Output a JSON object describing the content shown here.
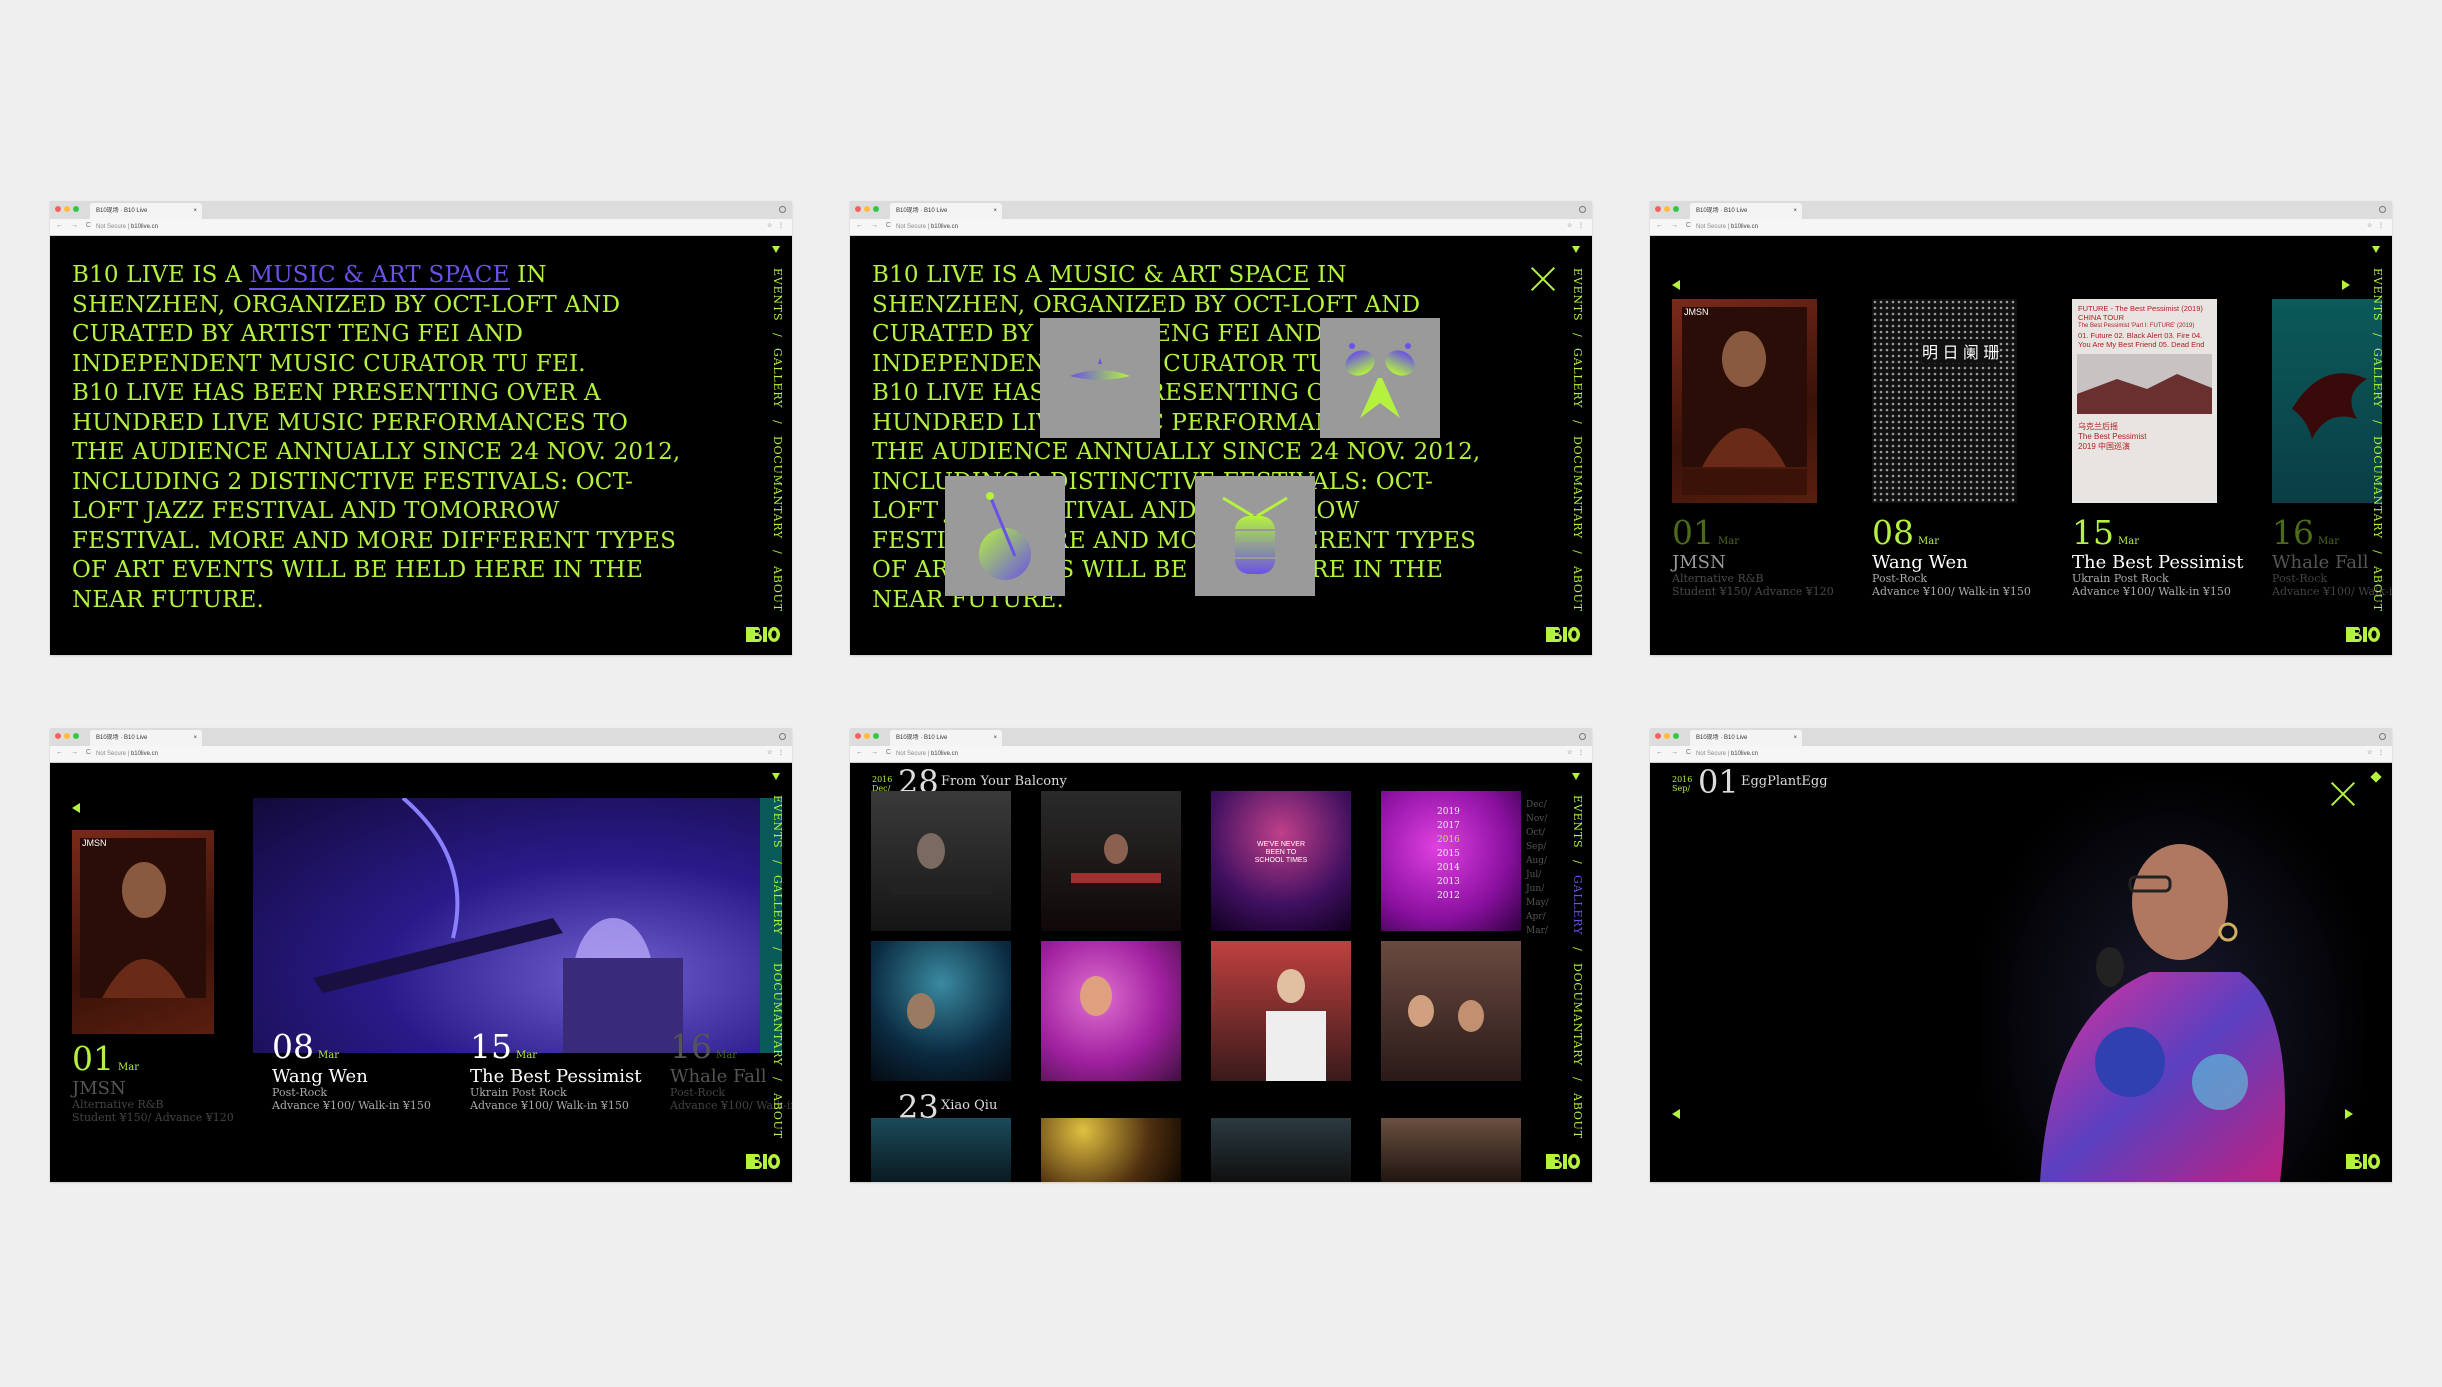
{
  "browser": {
    "tab_title": "B10现场 · B10 Live",
    "tab_close": "×",
    "not_secure": "Not Secure",
    "separator": "|",
    "url": "b10live.cn",
    "nav_glyphs": "← → C",
    "bar_icons": "☆ ⋮"
  },
  "nav": {
    "events": "EVENTS",
    "sep": "/",
    "gallery": "GALLERY",
    "documentary": "DOCUMANTARY",
    "about": "ABOUT"
  },
  "about": {
    "p1_a": "B10 LIVE IS A ",
    "p1_highlight": "MUSIC & ART SPACE",
    "p1_b": " IN SHENZHEN, ORGANIZED BY OCT-LOFT AND CURATED BY ARTIST TENG FEI AND INDEPENDENT MUSIC CURATOR TU FEI.",
    "p2": "B10 LIVE HAS BEEN PRESENTING OVER A HUNDRED LIVE MUSIC PERFORMANCES TO THE AUDIENCE ANNUALLY SINCE 24 NOV. 2012, INCLUDING 2 DISTINCTIVE FESTIVALS: OCT-LOFT JAZZ FESTIVAL AND TOMORROW FESTIVAL. MORE AND MORE DIFFERENT TYPES OF ART EVENTS WILL BE HELD HERE IN THE NEAR FUTURE."
  },
  "events": [
    {
      "day": "01",
      "month": "Mar",
      "name": "JMSN",
      "genre": "Alternative R&B",
      "price": "Student ¥150/ Advance ¥120"
    },
    {
      "day": "08",
      "month": "Mar",
      "name": "Wang Wen",
      "genre": "Post-Rock",
      "price": "Advance ¥100/ Walk-in ¥150"
    },
    {
      "day": "15",
      "month": "Mar",
      "name": "The Best Pessimist",
      "genre": "Ukrain Post Rock",
      "price": "Advance ¥100/ Walk-in ¥150"
    },
    {
      "day": "16",
      "month": "Mar",
      "name": "Whale Fall",
      "genre": "Post-Rock",
      "price": "Advance ¥100/ Walk-in ¥150"
    }
  ],
  "posters": {
    "jmsn_label": "JMSN",
    "pessimist_title": "FUTURE - The Best Pessimist (2019) CHINA TOUR",
    "pessimist_sub": "The Best Pessimist 'Part I: FUTURE' (2019)",
    "pessimist_tracks": "01. Future 02. Black Alert 03. Fire 04. You Are My Best Friend 05. Dead End",
    "pessimist_cn1": "乌克兰后摇",
    "pessimist_cn2": "The Best Pessimist",
    "pessimist_cn3": "2019 中国巡演",
    "wangwen_cn": "明 日 阑 珊"
  },
  "gallery": {
    "entry1": {
      "year": "2016",
      "month": "Dec/",
      "day": "28",
      "caption": "From Your Balcony"
    },
    "entry2": {
      "day": "23",
      "caption": "Xiao Qiu"
    },
    "years": [
      "2019",
      "2017",
      "2016",
      "2015",
      "2014",
      "2013",
      "2012"
    ],
    "months": [
      "Dec/",
      "Nov/",
      "Oct/",
      "Sep/",
      "Aug/",
      "Jul/",
      "Jun/",
      "May/",
      "Apr/",
      "Mar/"
    ],
    "sign_text": "WE'VE NEVER BEEN TO SCHOOL TIMES"
  },
  "detail": {
    "year": "2016",
    "month": "Sep/",
    "day": "01",
    "caption": "EggPlantEgg"
  },
  "colors": {
    "accent": "#b4f23f",
    "highlight": "#6a52e6",
    "bg": "#000000",
    "page": "#efefef"
  }
}
